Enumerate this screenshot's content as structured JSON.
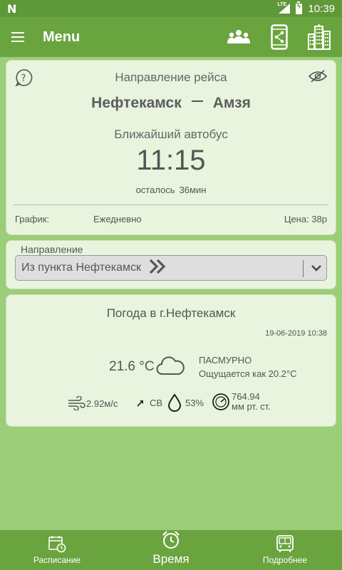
{
  "status_bar": {
    "network": "LTE",
    "time": "10:39"
  },
  "app_bar": {
    "title": "Menu",
    "actions": [
      "people-icon",
      "share-phone-icon",
      "city-icon"
    ]
  },
  "trip_card": {
    "header": "Направление рейса",
    "from": "Нефтекамск",
    "to": "Амзя",
    "next_bus_label": "Ближайший автобус",
    "next_bus_time": "11:15",
    "remaining_label": "осталось",
    "remaining_value": "36мин",
    "schedule_label": "График:",
    "schedule_value": "Ежедневно",
    "price": "Цена: 38р"
  },
  "direction": {
    "label": "Направление",
    "selected": "Из пункта Нефтекамск"
  },
  "weather": {
    "title": "Погода в г.Нефтекамск",
    "datetime": "19-06-2019 10:38",
    "temperature": "21.6 °C",
    "condition": "ПАСМУРНО",
    "feels_like": "Ощущается как 20.2°C",
    "wind_speed": "2.92м/с",
    "wind_direction": "СВ",
    "humidity": "53%",
    "pressure_value": "764.94",
    "pressure_unit": "мм рт. ст."
  },
  "bottom_nav": {
    "schedule": "Расписание",
    "time": "Время",
    "details": "Подробнее",
    "active": "time"
  },
  "colors": {
    "primary": "#6aa43f",
    "status_bar": "#5f9838",
    "background": "#9ccd78",
    "card": "#e8f4dd"
  }
}
